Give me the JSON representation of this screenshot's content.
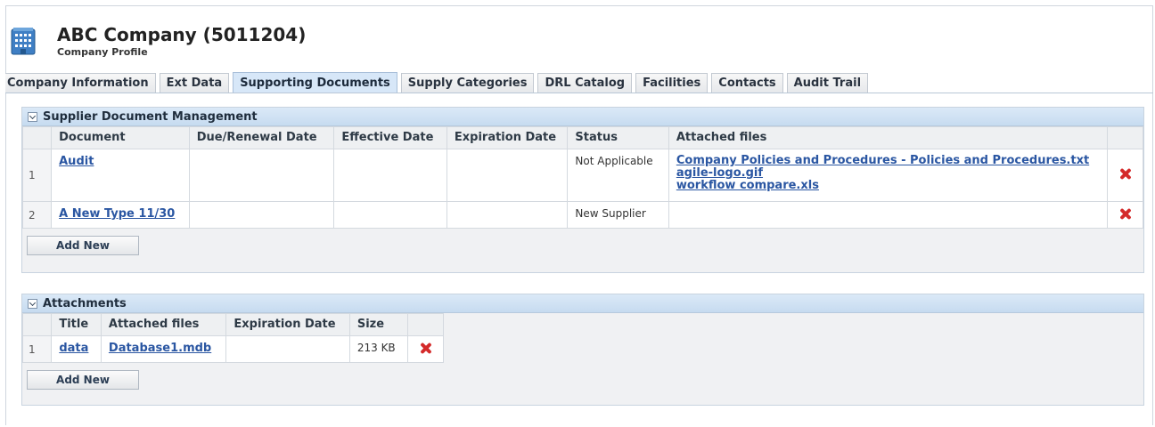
{
  "header": {
    "title": "ABC Company (5011204)",
    "subtitle": "Company Profile"
  },
  "tabs": [
    {
      "label": "Company Information",
      "active": false
    },
    {
      "label": "Ext Data",
      "active": false
    },
    {
      "label": "Supporting Documents",
      "active": true
    },
    {
      "label": "Supply Categories",
      "active": false
    },
    {
      "label": "DRL Catalog",
      "active": false
    },
    {
      "label": "Facilities",
      "active": false
    },
    {
      "label": "Contacts",
      "active": false
    },
    {
      "label": "Audit Trail",
      "active": false
    }
  ],
  "documents": {
    "title": "Supplier Document Management",
    "columns": [
      "Document",
      "Due/Renewal Date",
      "Effective Date",
      "Expiration Date",
      "Status",
      "Attached files"
    ],
    "rows": [
      {
        "num": "1",
        "document": "Audit",
        "due": "",
        "effective": "",
        "expiration": "",
        "status": "Not Applicable",
        "files": [
          "Company Policies and Procedures - Policies and Procedures.txt",
          "agile-logo.gif",
          "workflow compare.xls"
        ]
      },
      {
        "num": "2",
        "document": "A New Type 11/30",
        "due": "",
        "effective": "",
        "expiration": "",
        "status": "New Supplier",
        "files": []
      }
    ],
    "add_label": "Add New"
  },
  "attachments": {
    "title": "Attachments",
    "columns": [
      "Title",
      "Attached files",
      "Expiration Date",
      "Size"
    ],
    "rows": [
      {
        "num": "1",
        "title": "data",
        "file": "Database1.mdb",
        "expiration": "",
        "size": "213 KB"
      }
    ],
    "add_label": "Add New"
  },
  "colors": {
    "link": "#2a56a2",
    "section_header": "#c6dbf0",
    "delete_icon": "#d42a2a"
  }
}
